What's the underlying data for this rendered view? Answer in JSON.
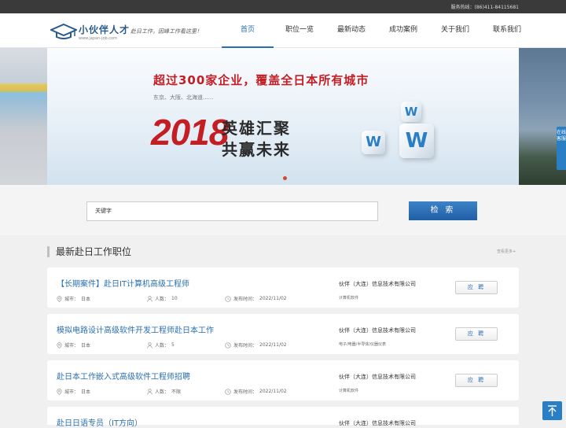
{
  "topbar": {
    "hotline": "服务热线：(86)411-84115681"
  },
  "logo": {
    "brand": "小伙伴人才",
    "slogan": "赴日工作，因峰工作看这里！",
    "url": "www.japan-job.com"
  },
  "nav": {
    "items": [
      "首页",
      "职位一览",
      "最新动态",
      "成功案例",
      "关于我们",
      "联系我们"
    ],
    "active_index": 0
  },
  "banner": {
    "headline": "超过300家企业，覆盖全日本所有城市",
    "cities": "东京、大阪、北海道......",
    "year": "2018",
    "slogan_line1": "英雄汇聚",
    "slogan_line2": "共赢未来",
    "cube_letter": "W",
    "slide_count": 1,
    "active_slide": 1
  },
  "online_service": {
    "label": "在线客服"
  },
  "search": {
    "placeholder": "关键字",
    "button_label": "检 索"
  },
  "section": {
    "title": "最新赴日工作职位",
    "more_link": "查看更多+"
  },
  "jobs": [
    {
      "title": "【长期案件】赴日IT计算机高级工程师",
      "city_label": "城市：",
      "city": "日本",
      "count_label": "人数：",
      "count": "10",
      "date_label": "发布时间：",
      "date": "2022/11/02",
      "company": "伙伴（大连）信息技术有限公司",
      "category": "计算机软件",
      "apply_label": "应 聘"
    },
    {
      "title": "模拟电路设计高级软件开发工程师赴日本工作",
      "city_label": "城市：",
      "city": "日本",
      "count_label": "人数：",
      "count": "5",
      "date_label": "发布时间：",
      "date": "2022/11/02",
      "company": "伙伴（大连）信息技术有限公司",
      "category": "电子/电器/半导体/仪器仪表",
      "apply_label": "应 聘"
    },
    {
      "title": "赴日本工作嵌入式高级软件工程师招聘",
      "city_label": "城市：",
      "city": "日本",
      "count_label": "人数：",
      "count": "不限",
      "date_label": "发布时间：",
      "date": "2022/11/02",
      "company": "伙伴（大连）信息技术有限公司",
      "category": "计算机软件",
      "apply_label": "应 聘"
    },
    {
      "title": "赴日日语专员（IT方向）",
      "company": "伙伴（大连）信息技术有限公司"
    }
  ],
  "colors": {
    "accent": "#2a6fb0",
    "banner_red": "#c41e25",
    "topbar": "#3a3a3a"
  }
}
